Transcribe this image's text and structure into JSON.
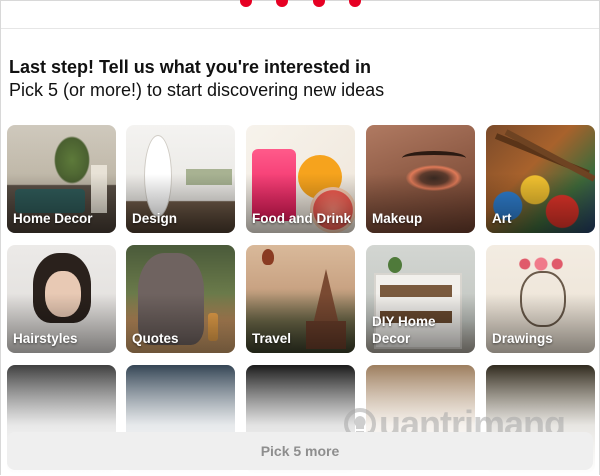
{
  "progress": {
    "steps": 4,
    "active": 4,
    "color": "#e60023"
  },
  "header": {
    "title": "Last step! Tell us what you're interested in",
    "subtitle": "Pick 5 (or more!) to start discovering new ideas"
  },
  "topics": [
    {
      "label": "Home Decor",
      "icon": "living-room-photo"
    },
    {
      "label": "Design",
      "icon": "architecture-photo"
    },
    {
      "label": "Food and Drink",
      "icon": "grapefruit-juice-photo"
    },
    {
      "label": "Makeup",
      "icon": "eye-makeup-photo"
    },
    {
      "label": "Art",
      "icon": "paint-brushes-photo"
    },
    {
      "label": "Hairstyles",
      "icon": "hairstyle-portrait-photo"
    },
    {
      "label": "Quotes",
      "icon": "elephant-and-girl-photo"
    },
    {
      "label": "Travel",
      "icon": "temples-and-balloon-photo"
    },
    {
      "label": "DIY Home Decor",
      "icon": "pallet-shelf-photo"
    },
    {
      "label": "Drawings",
      "icon": "flower-crown-drawing"
    },
    {
      "label": "",
      "icon": "partial-photo-1"
    },
    {
      "label": "",
      "icon": "partial-photo-2"
    },
    {
      "label": "",
      "icon": "partial-photo-3"
    },
    {
      "label": "",
      "icon": "partial-photo-4"
    },
    {
      "label": "",
      "icon": "partial-photo-5"
    }
  ],
  "footer": {
    "button_label": "Pick 5 more"
  },
  "watermark": {
    "text": "uantrimang",
    "icon": "lightbulb-q-icon"
  }
}
